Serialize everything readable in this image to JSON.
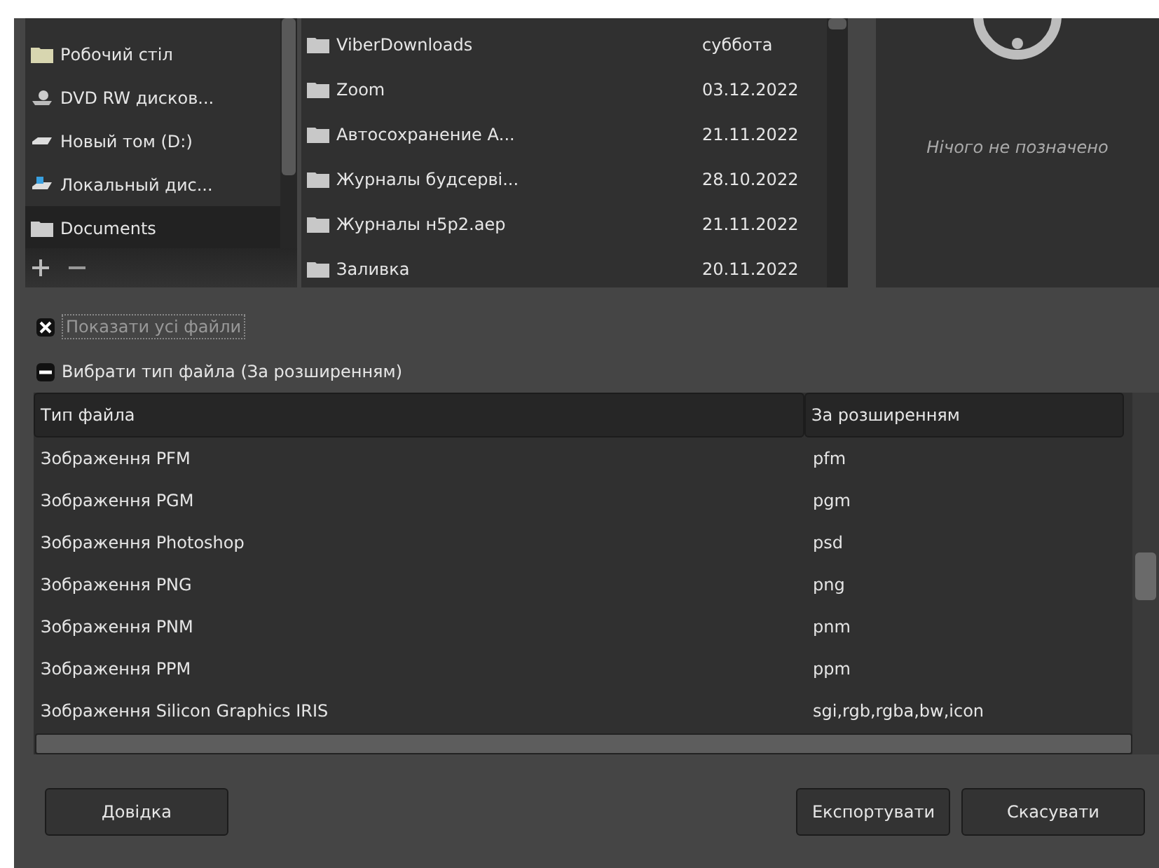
{
  "places": [
    {
      "label": "Робочий стіл",
      "kind": "desktop",
      "selected": false
    },
    {
      "label": "DVD RW дисков...",
      "kind": "dvd",
      "selected": false
    },
    {
      "label": "Новый том (D:)",
      "kind": "drive",
      "selected": false
    },
    {
      "label": "Локальный дис...",
      "kind": "system-drive",
      "selected": false
    },
    {
      "label": "Documents",
      "kind": "folder",
      "selected": true
    }
  ],
  "files": [
    {
      "name": "ViberDownloads",
      "modified": "суббота"
    },
    {
      "name": "Zoom",
      "modified": "03.12.2022"
    },
    {
      "name": "Автосохранение А...",
      "modified": "21.11.2022"
    },
    {
      "name": "Журналы будсерві...",
      "modified": "28.10.2022"
    },
    {
      "name": "Журналы н5р2.аер",
      "modified": "21.11.2022"
    },
    {
      "name": "Заливка",
      "modified": "20.11.2022"
    }
  ],
  "preview": {
    "text": "Нічого не позначено"
  },
  "show_all_files": {
    "label": "Показати усі файли",
    "checked": true,
    "focused": true
  },
  "file_type": {
    "label": "Вибрати тип файла (За розширенням)",
    "expanded": true
  },
  "table": {
    "columns": [
      "Тип файла",
      "За розширенням"
    ],
    "rows": [
      {
        "type": "Зображення PFM",
        "extension": "pfm"
      },
      {
        "type": "Зображення PGM",
        "extension": "pgm"
      },
      {
        "type": "Зображення Photoshop",
        "extension": "psd"
      },
      {
        "type": "Зображення PNG",
        "extension": "png"
      },
      {
        "type": "Зображення PNM",
        "extension": "pnm"
      },
      {
        "type": "Зображення PPM",
        "extension": "ppm"
      },
      {
        "type": "Зображення Silicon Graphics IRIS",
        "extension": "sgi,rgb,rgba,bw,icon"
      }
    ]
  },
  "buttons": {
    "help": "Довідка",
    "export": "Експортувати",
    "cancel": "Скасувати"
  }
}
